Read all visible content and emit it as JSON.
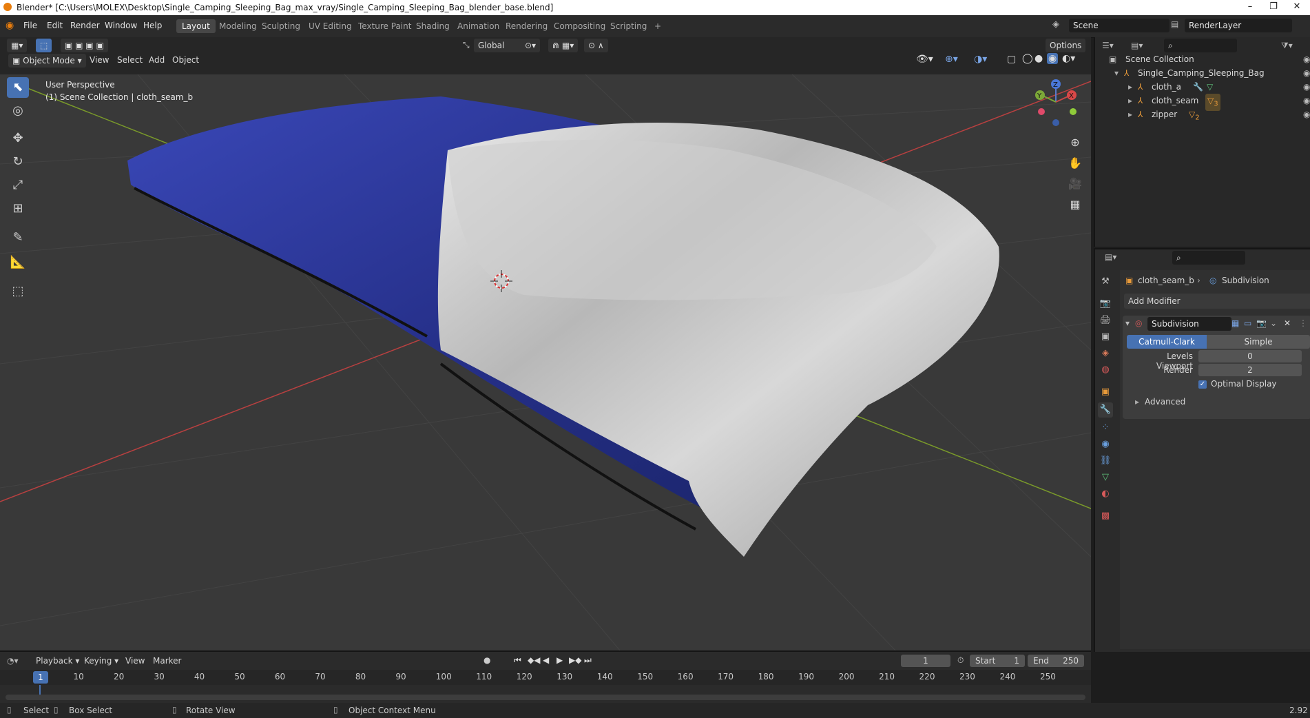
{
  "window": {
    "title": "Blender* [C:\\Users\\MOLEX\\Desktop\\Single_Camping_Sleeping_Bag_max_vray/Single_Camping_Sleeping_Bag_blender_base.blend]",
    "minimize": "–",
    "restore": "❐",
    "close": "✕"
  },
  "menu": [
    "File",
    "Edit",
    "Render",
    "Window",
    "Help"
  ],
  "workspaces": [
    "Layout",
    "Modeling",
    "Sculpting",
    "UV Editing",
    "Texture Paint",
    "Shading",
    "Animation",
    "Rendering",
    "Compositing",
    "Scripting"
  ],
  "workspace_add": "+",
  "scene": {
    "label": "Scene",
    "render_layer": "RenderLayer"
  },
  "viewport_header": {
    "transform_orientation": "Global",
    "options": "Options",
    "mode": "Object Mode",
    "menus": [
      "View",
      "Select",
      "Add",
      "Object"
    ]
  },
  "viewport_overlay": {
    "perspective": "User Perspective",
    "collection_info": "(1) Scene Collection | cloth_seam_b"
  },
  "gizmo": {
    "z": "Z",
    "y": "Y",
    "x": "X"
  },
  "outliner": {
    "root": "Scene Collection",
    "collection": "Single_Camping_Sleeping_Bag",
    "objects": [
      {
        "name": "cloth_a",
        "badge": ""
      },
      {
        "name": "cloth_seam",
        "badge": "3"
      },
      {
        "name": "zipper",
        "badge": "2"
      }
    ]
  },
  "properties": {
    "object_name": "cloth_seam_b",
    "modifier_context": "Subdivision",
    "add_modifier": "Add Modifier",
    "modifier": {
      "name": "Subdivision",
      "types": [
        "Catmull-Clark",
        "Simple"
      ],
      "active_type": "Catmull-Clark",
      "levels_viewport_label": "Levels Viewport",
      "levels_viewport": "0",
      "render_label": "Render",
      "render": "2",
      "optimal_display_label": "Optimal Display",
      "optimal_display": true,
      "advanced": "Advanced"
    }
  },
  "timeline": {
    "menus": [
      "Playback",
      "Keying",
      "View",
      "Marker"
    ],
    "current_frame": "1",
    "start_label": "Start",
    "start": "1",
    "end_label": "End",
    "end": "250",
    "ruler": [
      "10",
      "20",
      "30",
      "40",
      "50",
      "60",
      "70",
      "80",
      "90",
      "100",
      "110",
      "120",
      "130",
      "140",
      "150",
      "160",
      "170",
      "180",
      "190",
      "200",
      "210",
      "220",
      "230",
      "240",
      "250"
    ],
    "playhead": "1"
  },
  "statusbar": {
    "select": "Select",
    "box_select": "Box Select",
    "rotate_view": "Rotate View",
    "context_menu": "Object Context Menu",
    "version": "2.92"
  },
  "colors": {
    "accent": "#4772b3",
    "bag_blue": "#2a3590",
    "bag_silver": "#c9c9c9",
    "grid_red": "#b94040",
    "grid_green": "#7a9a2a"
  }
}
